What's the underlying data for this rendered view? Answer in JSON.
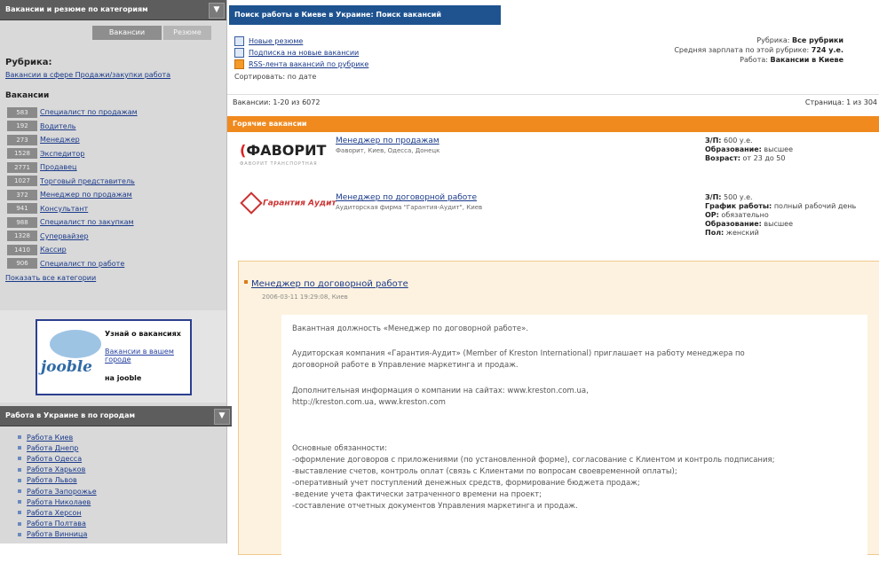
{
  "sidebar": {
    "header": "Вакансии и резюме по категориям",
    "tabs": [
      "Вакансии",
      "Резюме"
    ],
    "rubric_title": "Рубрика:",
    "rubric_link": "Вакансии в сфере Продажи/закупки работа",
    "vacancies_title": "Вакансии",
    "categories": [
      {
        "count": "583",
        "label": "Специалист по продажам"
      },
      {
        "count": "192",
        "label": "Водитель"
      },
      {
        "count": "273",
        "label": "Менеджер"
      },
      {
        "count": "1528",
        "label": "Экспедитор"
      },
      {
        "count": "2771",
        "label": "Продавец"
      },
      {
        "count": "1027",
        "label": "Торговый представитель"
      },
      {
        "count": "372",
        "label": "Менеджер по продажам"
      },
      {
        "count": "941",
        "label": "Консультант"
      },
      {
        "count": "988",
        "label": "Специалист по закупкам"
      },
      {
        "count": "1328",
        "label": "Супервайзер"
      },
      {
        "count": "1410",
        "label": "Кассир"
      },
      {
        "count": "906",
        "label": "Специалист по работе"
      }
    ],
    "more_categories": "Показать все категории",
    "banner": {
      "logo": "jooble",
      "title": "Узнай о вакансиях",
      "text": "Вакансии в вашем городе",
      "footer": "на jooble"
    },
    "regions_header": "Работа в Украине в по городам",
    "regions": [
      "Работа Киев",
      "Работа Днепр",
      "Работа Одесса",
      "Работа Харьков",
      "Работа Львов",
      "Работа Запорожье",
      "Работа Николаев",
      "Работа Херсон",
      "Работа Полтава",
      "Работа Винница"
    ]
  },
  "main": {
    "header": "Поиск работы в Киеве в Украине: Поиск вакансий",
    "options": [
      {
        "icon": "email-icon",
        "label": "Новые резюме"
      },
      {
        "icon": "email-icon",
        "label": "Подписка на новые вакансии"
      },
      {
        "icon": "rss-icon",
        "label": "RSS-лента вакансий по рубрике"
      }
    ],
    "sort_label": "Сортировать: по дате",
    "filters": [
      {
        "label": "Рубрика:",
        "value": "Все рубрики"
      },
      {
        "label": "Средняя зарплата по этой рубрике:",
        "value": "724 у.е."
      },
      {
        "label": "Работа:",
        "value": "Вакансии в Киеве"
      }
    ],
    "pager_left": "Вакансии: 1-20 из 6072",
    "pager_right": "Страница: 1 из 304",
    "hot_header": "Горячие вакансии",
    "jobs": [
      {
        "logo": "ФАВОРИТ",
        "logo_sub": "ФАВОРИТ ТРАНСПОРТНАЯ",
        "title": "Менеджер по продажам",
        "company": "Фаворит, Киев, Одесса, Донецк",
        "details": [
          {
            "label": "З/П:",
            "value": "600 у.е."
          },
          {
            "label": "Образование:",
            "value": "высшее"
          },
          {
            "label": "Возраст:",
            "value": "от 23 до 50"
          }
        ]
      },
      {
        "logo": "Гарантия Аудит",
        "title": "Менеджер по договорной работе",
        "company": "Аудиторская фирма \"Гарантия-Аудит\", Киев",
        "details": [
          {
            "label": "З/П:",
            "value": "500 у.е."
          },
          {
            "label": "График работы:",
            "value": "полный рабочий день"
          },
          {
            "label": "ОР:",
            "value": "обязательно"
          },
          {
            "label": "Образование:",
            "value": "высшее"
          },
          {
            "label": "Пол:",
            "value": "женский"
          }
        ]
      }
    ],
    "detail": {
      "title": "Менеджер по договорной работе",
      "date": "2006-03-11 19:29:08, Киев",
      "paragraphs": [
        "Вакантная должность «Менеджер по договорной работе».",
        "Аудиторская компания «Гарантия-Аудит» (Member of Kreston International) приглашает на работу менеджера по договорной работе в Управление маркетинга и продаж.",
        "Дополнительная информация о компании на сайтах: www.kreston.com.ua, http://kreston.com.ua, www.kreston.com",
        "Основные обязанности:\n-оформление договоров с приложениями (по установленной форме), согласование с Клиентом и контроль подписания;\n-выставление счетов, контроль оплат (связь с Клиентами по вопросам своевременной оплаты);\n-оперативный учет поступлений денежных средств, формирование бюджета продаж;\n-ведение учета фактически затраченного времени на проект;\n-составление отчетных документов Управления маркетинга и продаж."
      ]
    }
  }
}
